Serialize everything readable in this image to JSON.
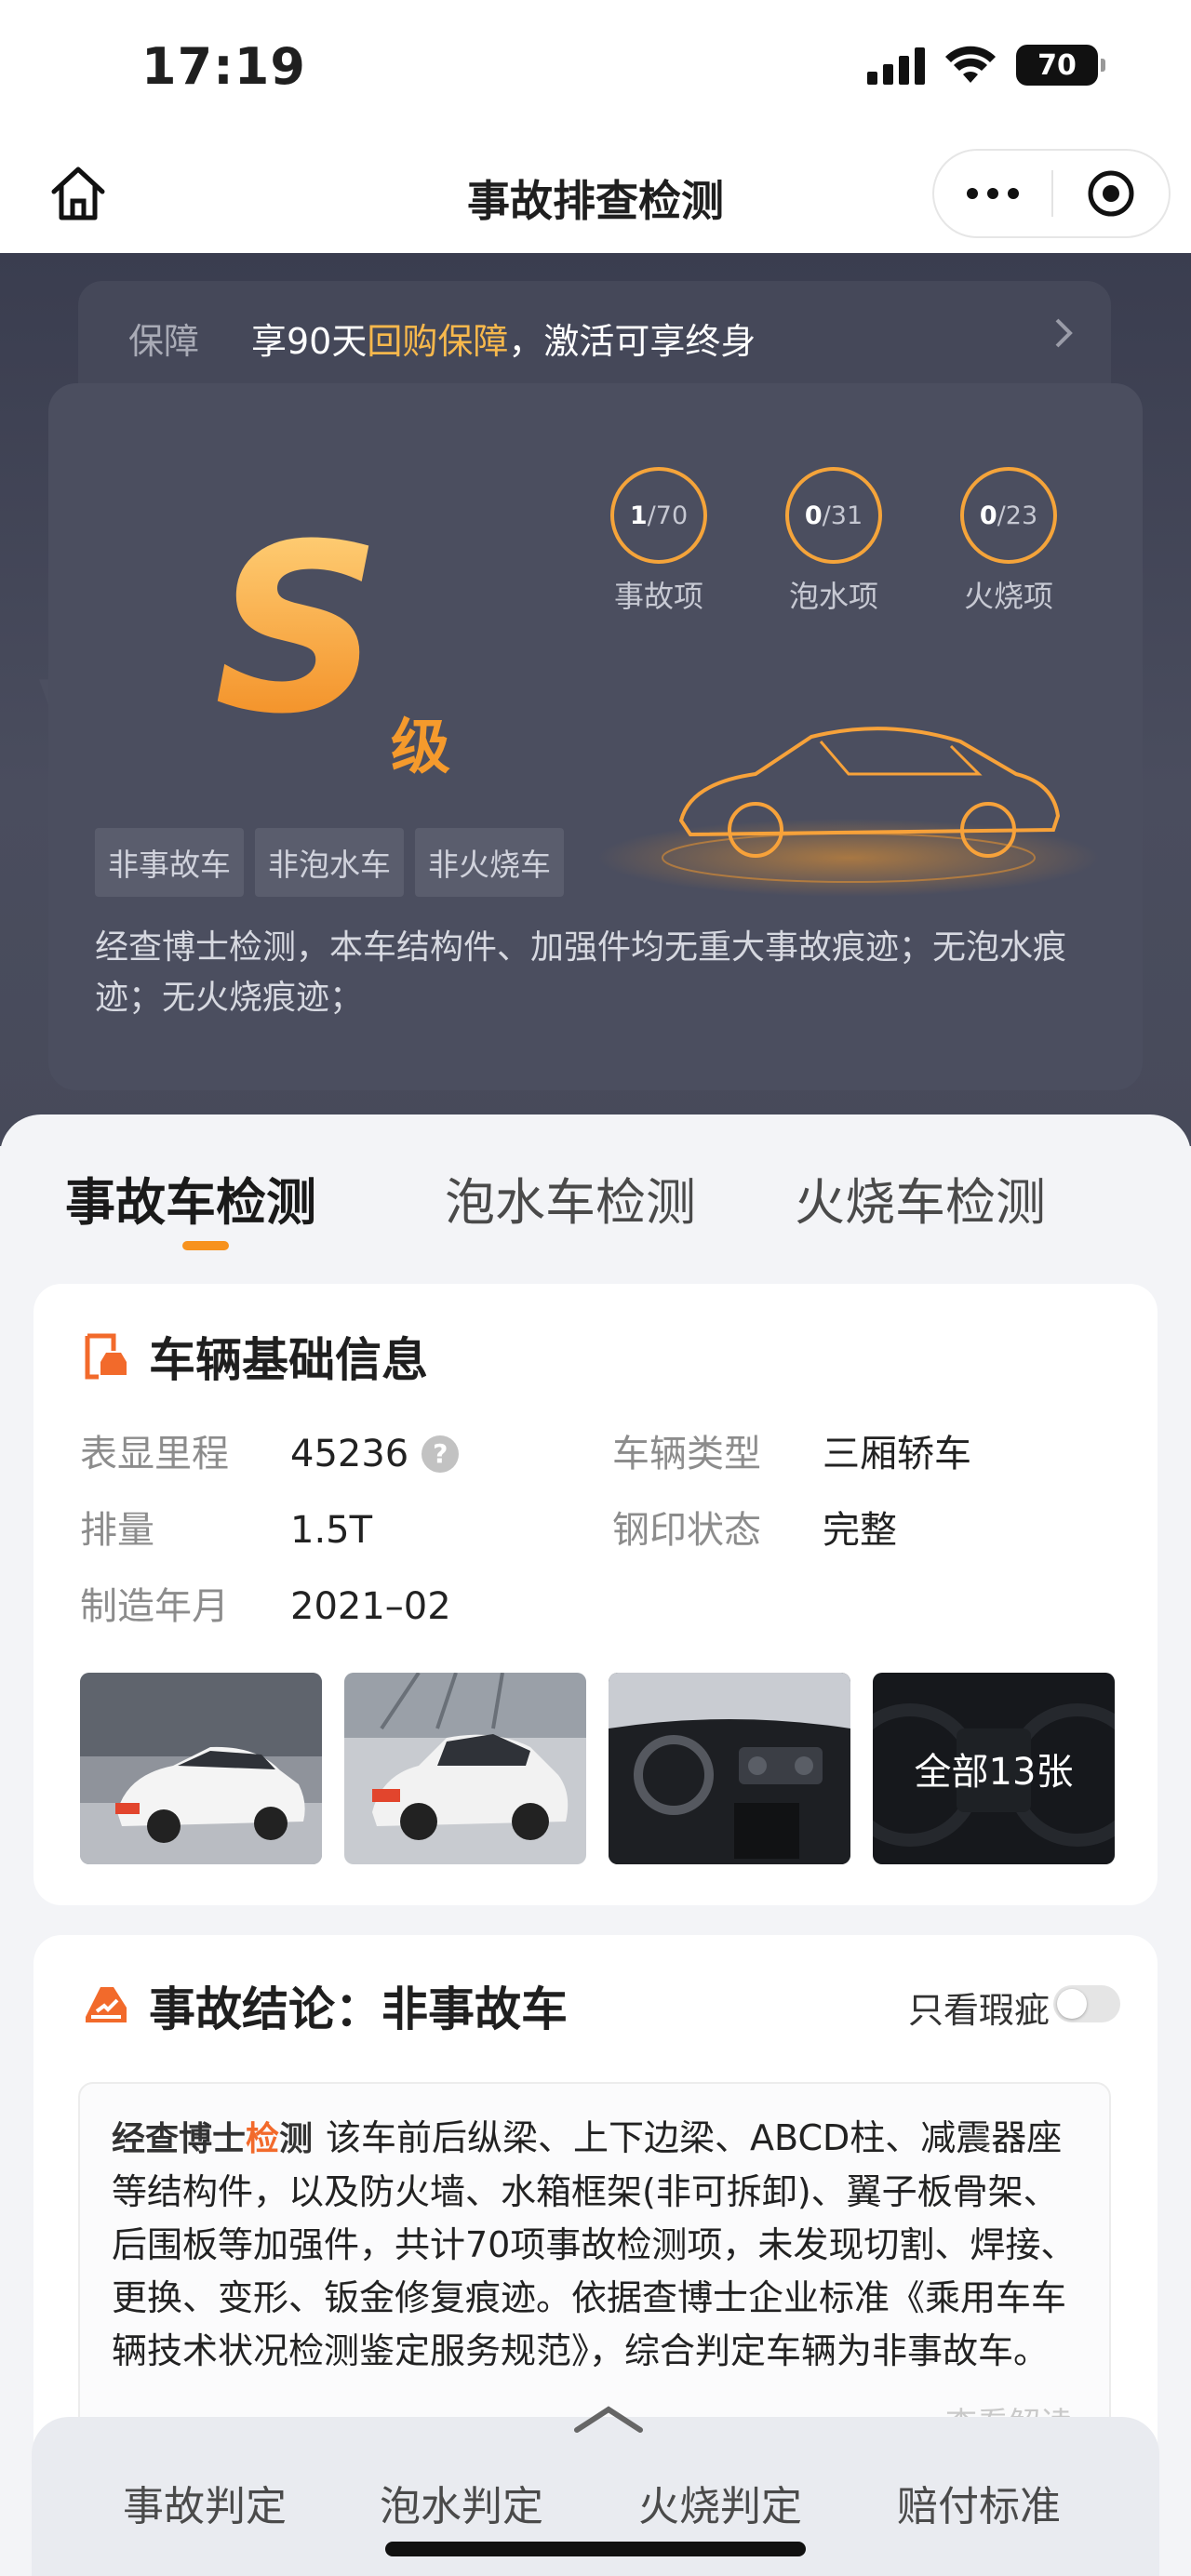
{
  "status_bar": {
    "time": "17:19",
    "battery": "70"
  },
  "nav": {
    "title": "事故排查检测"
  },
  "guarantee": {
    "label": "保障",
    "text_before": "享90天",
    "text_highlight": "回购保障",
    "text_after": "，激活可享终身"
  },
  "grade": {
    "letter": "S",
    "suffix": "级",
    "rings": [
      {
        "checked": "1",
        "total": "/70",
        "label": "事故项"
      },
      {
        "checked": "0",
        "total": "/31",
        "label": "泡水项"
      },
      {
        "checked": "0",
        "total": "/23",
        "label": "火烧项"
      }
    ],
    "tags": [
      "非事故车",
      "非泡水车",
      "非火烧车"
    ],
    "summary": "经查博士检测，本车结构件、加强件均无重大事故痕迹；无泡水痕迹；无火烧痕迹；"
  },
  "tabs": [
    {
      "label": "事故车检测",
      "active": true
    },
    {
      "label": "泡水车检测",
      "active": false
    },
    {
      "label": "火烧车检测",
      "active": false
    }
  ],
  "vehicle_info": {
    "title": "车辆基础信息",
    "mileage_label": "表显里程",
    "mileage_value": "45236",
    "type_label": "车辆类型",
    "type_value": "三厢轿车",
    "displacement_label": "排量",
    "displacement_value": "1.5T",
    "stamp_label": "钢印状态",
    "stamp_value": "完整",
    "date_label": "制造年月",
    "date_value": "2021–02",
    "all_photos": "全部13张"
  },
  "conclusion": {
    "title": "事故结论：非事故车",
    "only_flaw": "只看瑕疵",
    "brand_prefix": "经查博士",
    "brand_mark": "检",
    "brand_suffix": "测",
    "text": "该车前后纵梁、上下边梁、ABCD柱、减震器座等结构件，以及防火墙、水箱框架(非可拆卸)、翼子板骨架、后围板等加强件，共计70项事故检测项，未发现切割、焊接、更换、变形、钣金修复痕迹。依据查博士企业标准《乘用车车辆技术状况检测鉴定服务规范》，综合判定车辆为非事故车。",
    "see_more": "查看解读"
  },
  "bottom_tabs": [
    "事故判定",
    "泡水判定",
    "火烧判定",
    "赔付标准"
  ],
  "colors": {
    "accent": "#f7921e",
    "hero_bg": "#3a3d4f",
    "highlight": "#f7b84c"
  }
}
